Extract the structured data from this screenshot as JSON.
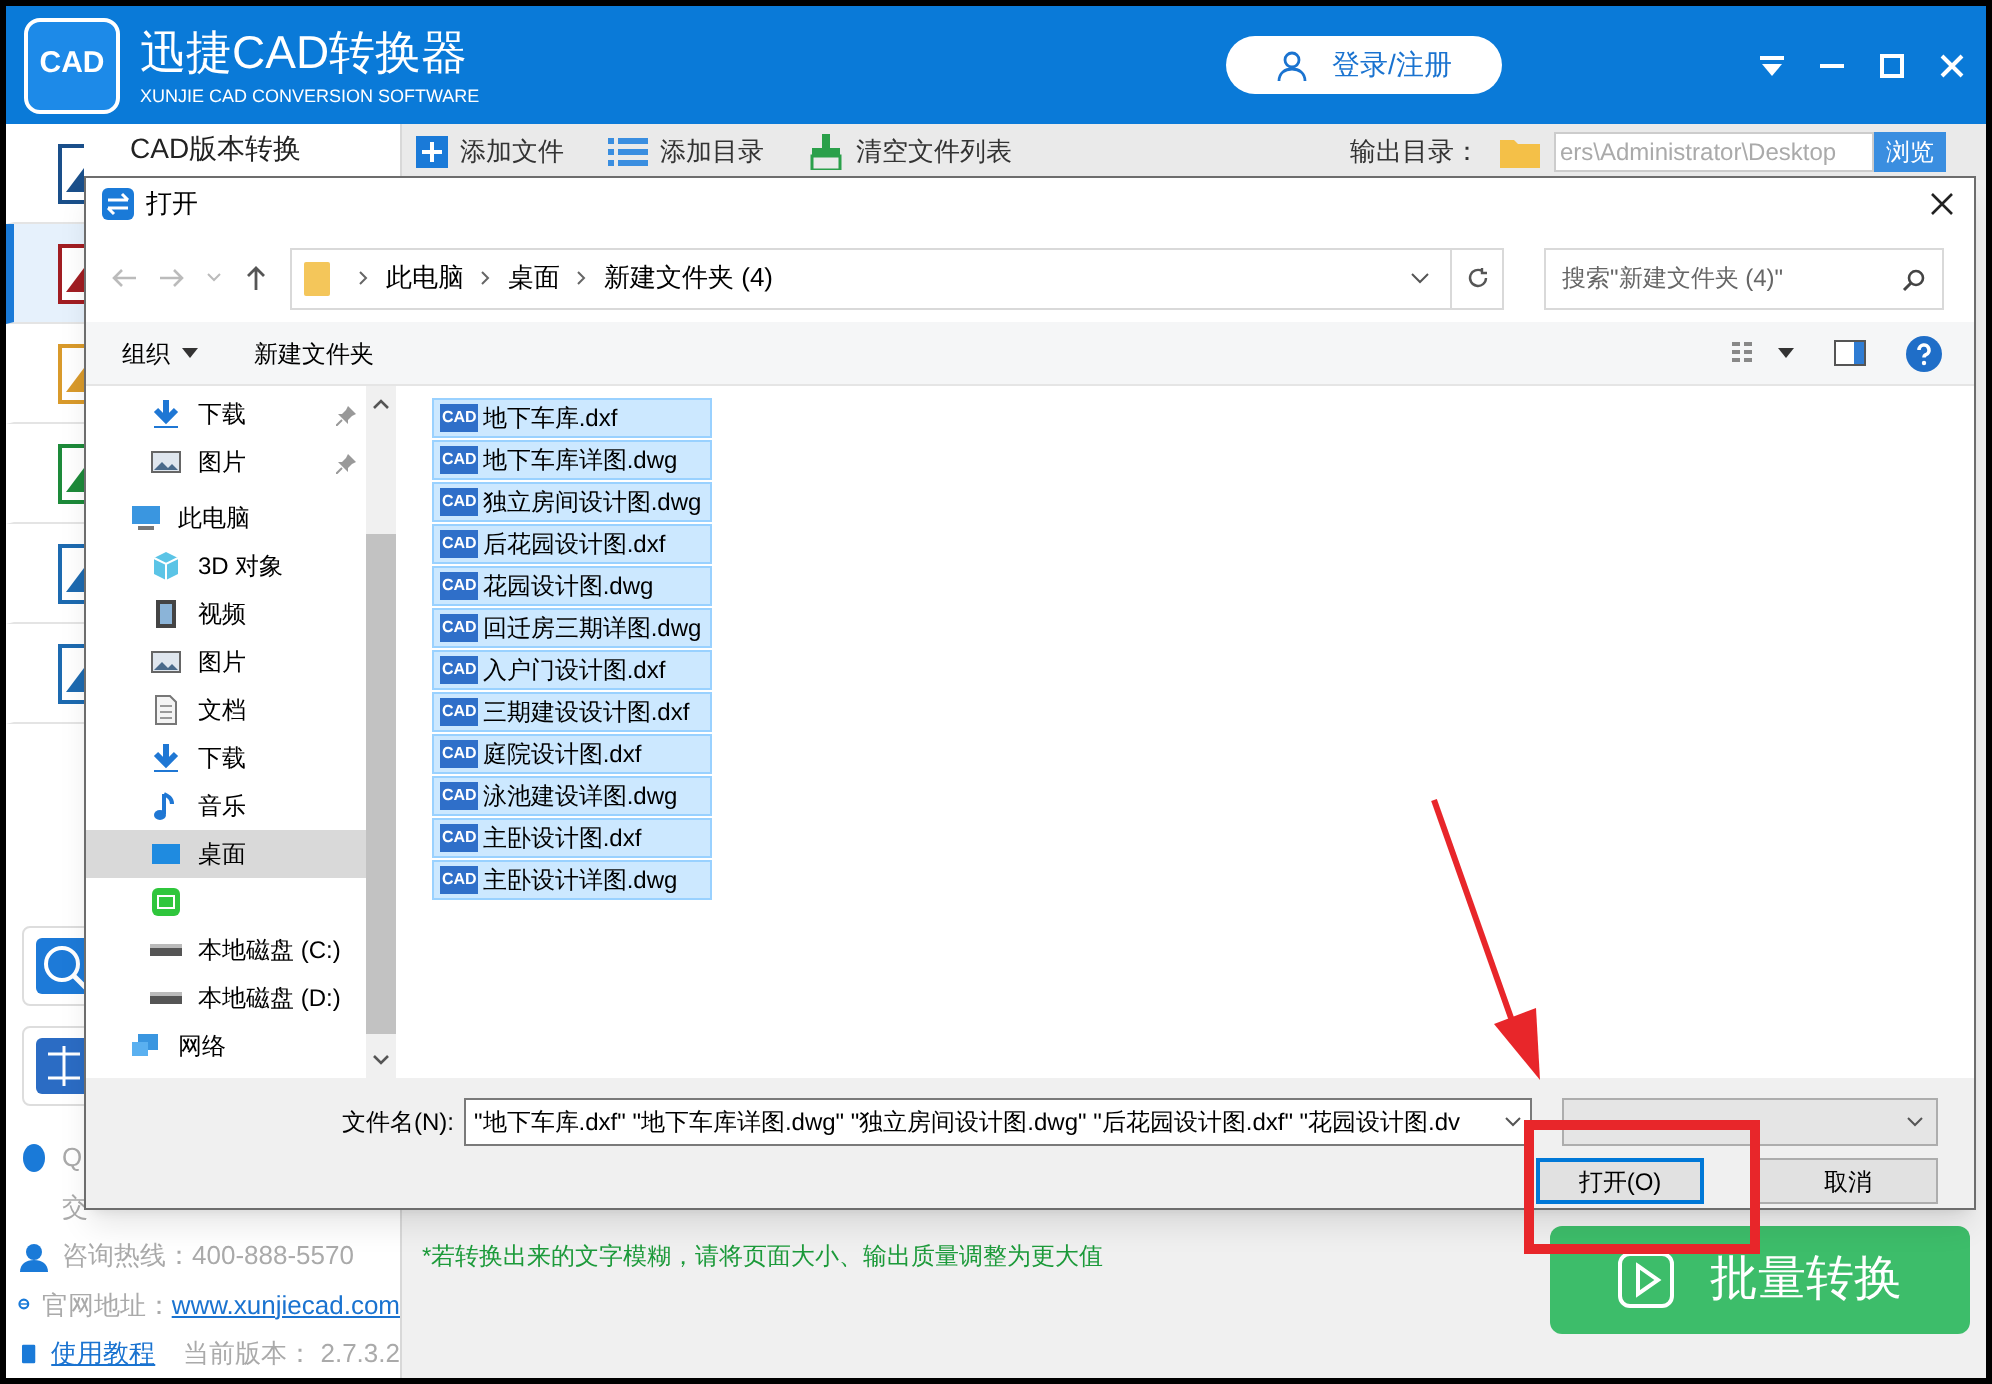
{
  "app": {
    "logo_text": "CAD",
    "title": "迅捷CAD转换器",
    "subtitle": "XUNJIE CAD CONVERSION SOFTWARE",
    "login_button": "登录/注册"
  },
  "sidebar": {
    "items": [
      {
        "label": "CAD版本转换",
        "kind": "version",
        "selected": false
      },
      {
        "kind": "cad-pdf",
        "selected": true
      },
      {
        "kind": "cad-img",
        "selected": false
      },
      {
        "kind": "pdf-cad",
        "selected": false
      },
      {
        "kind": "dwg",
        "selected": false
      },
      {
        "kind": "dwg",
        "selected": false
      }
    ],
    "contact": {
      "qq": "Q",
      "group": "交",
      "hotline_label": "咨询热线：",
      "hotline": "400-888-5570",
      "site_label": "官网地址：",
      "site": "www.xunjiecad.com",
      "tutorial": "使用教程",
      "version_label": "当前版本：",
      "version": "2.7.3.2"
    }
  },
  "toolbar": {
    "buttons": [
      {
        "label": "添加文件",
        "kind": "add"
      },
      {
        "label": "添加目录",
        "kind": "list"
      },
      {
        "label": "清空文件列表",
        "kind": "clear"
      }
    ],
    "output_label": "输出目录：",
    "output_path": "ers\\Administrator\\Desktop",
    "browse": "浏览"
  },
  "note": "*若转换出来的文字模糊，请将页面大小、输出质量调整为更大值",
  "convert_button": "批量转换",
  "dialog": {
    "title": "打开",
    "breadcrumb": [
      "此电脑",
      "桌面",
      "新建文件夹 (4)"
    ],
    "search_placeholder": "搜索\"新建文件夹 (4)\"",
    "organize": "组织",
    "new_folder": "新建文件夹",
    "quick_access": [
      {
        "label": "下载",
        "kind": "download",
        "pinned": true
      },
      {
        "label": "图片",
        "kind": "picture",
        "pinned": true
      }
    ],
    "nav": [
      {
        "label": "此电脑",
        "kind": "computer",
        "selected": false,
        "children": [
          {
            "label": "3D 对象",
            "kind": "cube",
            "selected": false
          },
          {
            "label": "视频",
            "kind": "video",
            "selected": false
          },
          {
            "label": "图片",
            "kind": "picture",
            "selected": false
          },
          {
            "label": "文档",
            "kind": "doc",
            "selected": false
          },
          {
            "label": "下载",
            "kind": "download",
            "selected": false
          },
          {
            "label": "音乐",
            "kind": "music",
            "selected": false
          },
          {
            "label": "桌面",
            "kind": "desktop",
            "selected": true
          },
          {
            "kind": "app",
            "selected": false
          },
          {
            "label": "本地磁盘 (C:)",
            "kind": "drive",
            "selected": false
          },
          {
            "label": "本地磁盘 (D:)",
            "kind": "drive",
            "selected": false
          }
        ]
      },
      {
        "label": "网络",
        "kind": "network",
        "selected": false
      }
    ],
    "files": [
      {
        "icon_text": "CAD",
        "name": "地下车库.dxf",
        "selected": true
      },
      {
        "icon_text": "CAD",
        "name": "地下车库详图.dwg",
        "selected": true
      },
      {
        "icon_text": "CAD",
        "name": "独立房间设计图.dwg",
        "selected": true
      },
      {
        "icon_text": "CAD",
        "name": "后花园设计图.dxf",
        "selected": true
      },
      {
        "icon_text": "CAD",
        "name": "花园设计图.dwg",
        "selected": true
      },
      {
        "icon_text": "CAD",
        "name": "回迁房三期详图.dwg",
        "selected": true
      },
      {
        "icon_text": "CAD",
        "name": "入户门设计图.dxf",
        "selected": true
      },
      {
        "icon_text": "CAD",
        "name": "三期建设设计图.dxf",
        "selected": true
      },
      {
        "icon_text": "CAD",
        "name": "庭院设计图.dxf",
        "selected": true
      },
      {
        "icon_text": "CAD",
        "name": "泳池建设详图.dwg",
        "selected": true
      },
      {
        "icon_text": "CAD",
        "name": "主卧设计图.dxf",
        "selected": true
      },
      {
        "icon_text": "CAD",
        "name": "主卧设计详图.dwg",
        "selected": true
      }
    ],
    "filename_label": "文件名(N):",
    "filename_value": "\"地下车库.dxf\" \"地下车库详图.dwg\" \"独立房间设计图.dwg\" \"后花园设计图.dxf\" \"花园设计图.dv",
    "open_button": "打开(O)",
    "cancel_button": "取消"
  }
}
